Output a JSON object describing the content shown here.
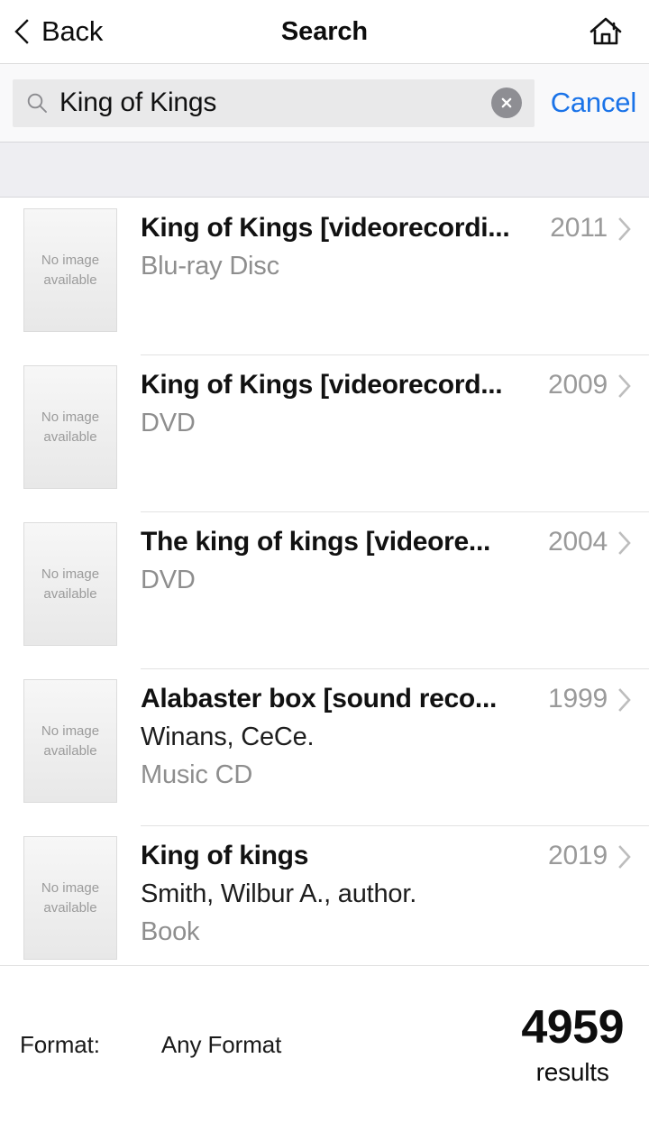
{
  "header": {
    "back_label": "Back",
    "title": "Search",
    "back_icon": "chevron-left-icon",
    "home_icon": "home-icon"
  },
  "search": {
    "value": "King of Kings",
    "placeholder": "Search",
    "cancel_label": "Cancel",
    "search_icon": "search-icon",
    "clear_icon": "clear-circle-icon",
    "cancel_color": "#1a73e8"
  },
  "results": {
    "thumb_placeholder_line1": "No image",
    "thumb_placeholder_line2": "available",
    "items": [
      {
        "title": "King of Kings [videorecordi...",
        "author": "",
        "format": "Blu-ray Disc",
        "year": "2011"
      },
      {
        "title": "King of Kings [videorecord...",
        "author": "",
        "format": "DVD",
        "year": "2009"
      },
      {
        "title": "The king of kings [videore...",
        "author": "",
        "format": "DVD",
        "year": "2004"
      },
      {
        "title": "Alabaster box [sound reco...",
        "author": "Winans, CeCe.",
        "format": "Music CD",
        "year": "1999"
      },
      {
        "title": "King of kings",
        "author": "Smith, Wilbur A., author.",
        "format": "Book",
        "year": "2019"
      }
    ]
  },
  "footer": {
    "format_label": "Format:",
    "format_value": "Any Format",
    "count_number": "4959",
    "count_word": "results"
  }
}
